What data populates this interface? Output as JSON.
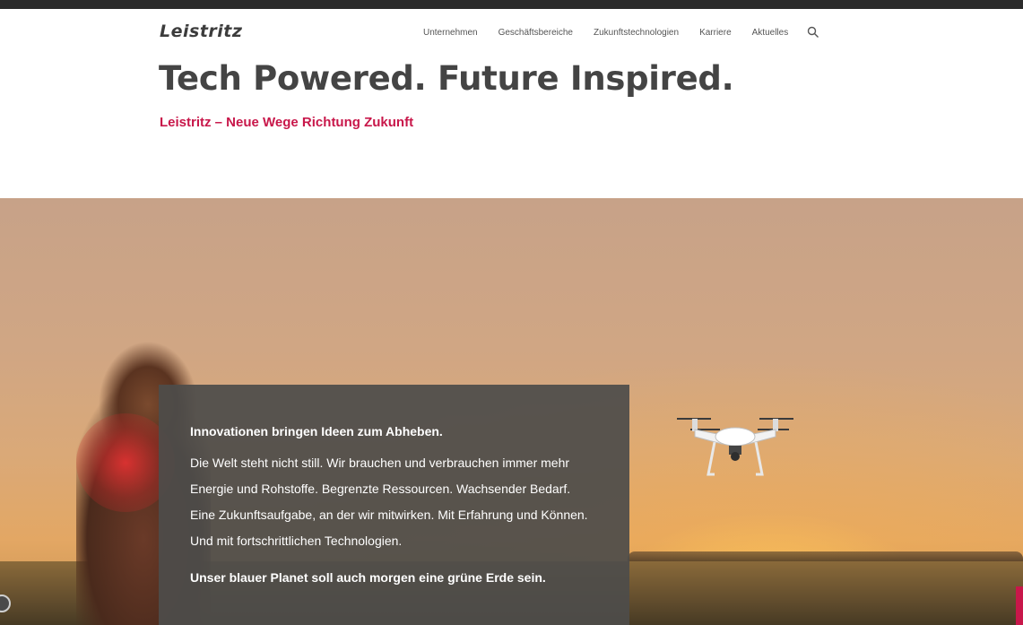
{
  "header": {
    "logo": "Leistritz",
    "nav": [
      "Unternehmen",
      "Geschäftsbereiche",
      "Zukunftstechnologien",
      "Karriere",
      "Aktuelles"
    ],
    "search_icon": "search-icon"
  },
  "hero_title": "Tech Powered. Future Inspired.",
  "hero_subtitle": "Leistritz – Neue Wege Richtung Zukunft",
  "content_box": {
    "lead": "Innovationen bringen Ideen zum Abheben.",
    "body": "Die Welt steht nicht still. Wir brauchen und verbrauchen immer mehr Energie und Rohstoffe. Begrenzte Ressourcen. Wachsender Bedarf. Eine Zukunftsaufgabe, an der wir mitwirken. Mit Erfahrung und Können. Und mit fortschrittlichen Technologien.",
    "closing": "Unser blauer Planet soll auch morgen eine grüne Erde sein."
  },
  "colors": {
    "accent": "#c8174a",
    "text_dark": "#444444",
    "box_bg": "#4e4c4a"
  }
}
